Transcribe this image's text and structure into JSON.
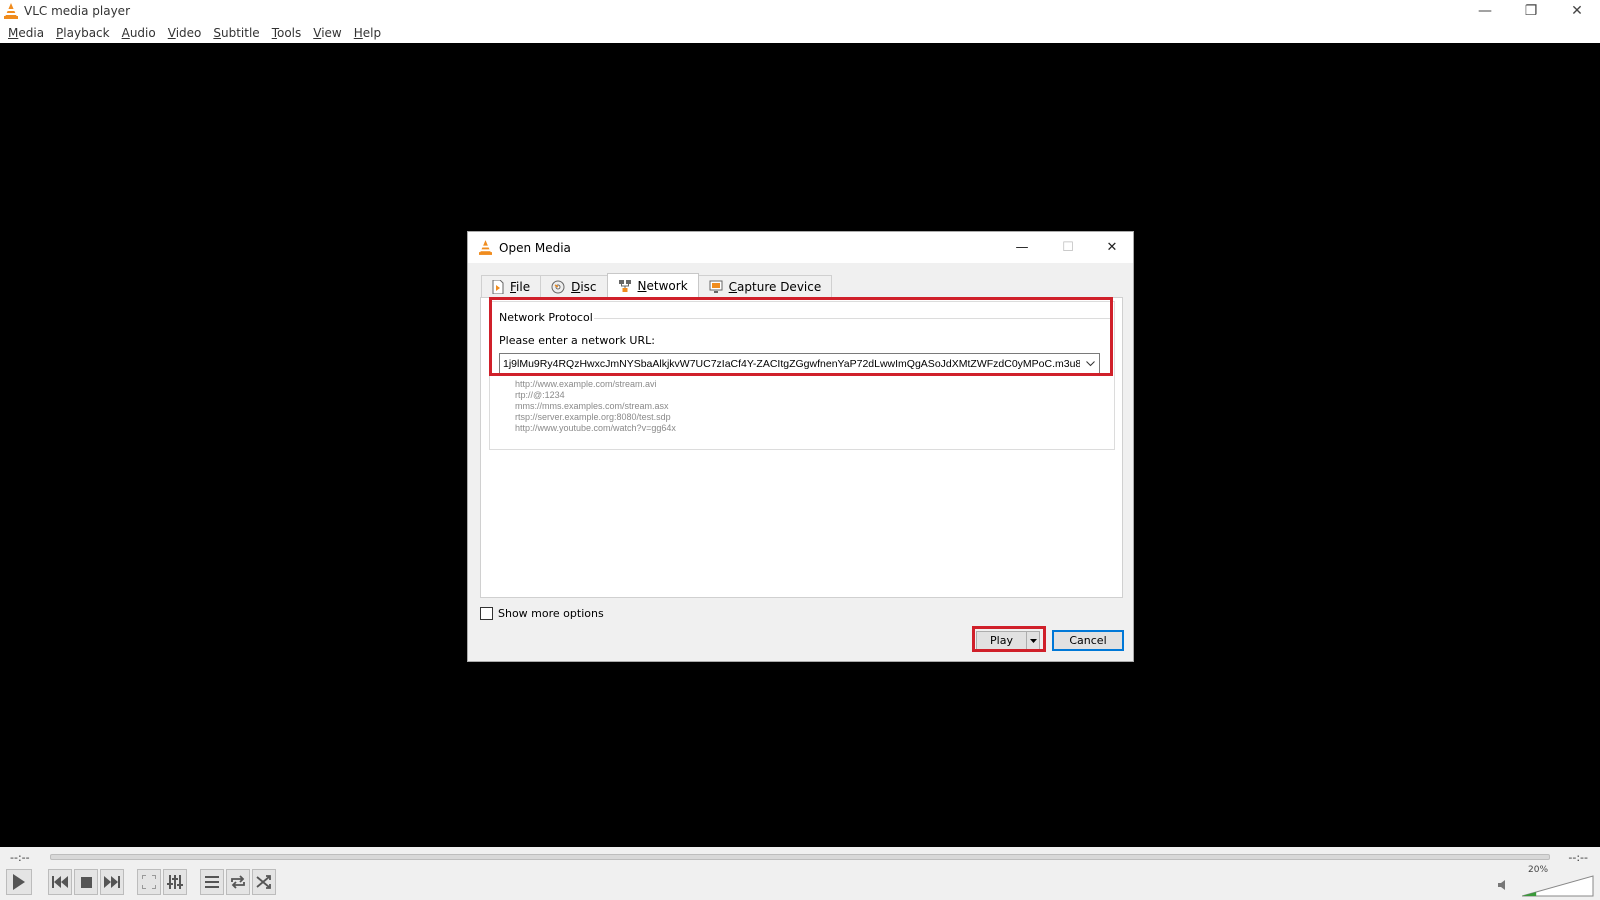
{
  "window": {
    "title": "VLC media player",
    "minimize": "—",
    "restore": "❐",
    "close": "✕"
  },
  "menu": {
    "items": [
      "Media",
      "Playback",
      "Audio",
      "Video",
      "Subtitle",
      "Tools",
      "View",
      "Help"
    ]
  },
  "controls": {
    "time_elapsed": "--:--",
    "time_total": "--:--",
    "volume_percent": "20%",
    "volume_level": 0.2
  },
  "dialog": {
    "title": "Open Media",
    "minimize": "—",
    "maximize": "☐",
    "close": "✕",
    "tabs": [
      {
        "label": "File",
        "icon": "file-icon"
      },
      {
        "label": "Disc",
        "icon": "disc-icon"
      },
      {
        "label": "Network",
        "icon": "network-icon"
      },
      {
        "label": "Capture Device",
        "icon": "capture-device-icon"
      }
    ],
    "active_tab": "Network",
    "group_title": "Network Protocol",
    "url_label": "Please enter a network URL:",
    "url_value": "1j9lMu9Ry4RQzHwxcJmNYSbaAlkjkvW7UC7zIaCf4Y-ZACItgZGgwfnenYaP72dLwwImQgASoJdXMtZWFzdC0yMPoC.m3u8",
    "examples": [
      "http://www.example.com/stream.avi",
      "rtp://@:1234",
      "mms://mms.examples.com/stream.asx",
      "rtsp://server.example.org:8080/test.sdp",
      "http://www.youtube.com/watch?v=gg64x"
    ],
    "show_more_options": "Show more options",
    "play_label": "Play",
    "cancel_label": "Cancel"
  },
  "colors": {
    "highlight": "#d0202a",
    "accent": "#0078d7",
    "vlc_orange": "#f08c1e"
  }
}
